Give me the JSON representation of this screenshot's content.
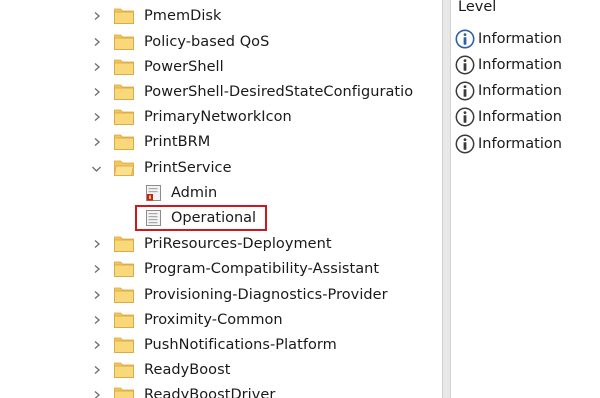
{
  "tree": {
    "items": [
      {
        "label": "PmemDisk",
        "expanded": false
      },
      {
        "label": "Policy-based QoS",
        "expanded": false
      },
      {
        "label": "PowerShell",
        "expanded": false
      },
      {
        "label": "PowerShell-DesiredStateConfiguratio",
        "expanded": false
      },
      {
        "label": "PrimaryNetworkIcon",
        "expanded": false
      },
      {
        "label": "PrintBRM",
        "expanded": false
      },
      {
        "label": "PrintService",
        "expanded": true
      },
      {
        "label": "Admin",
        "child": true
      },
      {
        "label": "Operational",
        "child": true,
        "selected": true
      },
      {
        "label": "PriResources-Deployment",
        "expanded": false
      },
      {
        "label": "Program-Compatibility-Assistant",
        "expanded": false
      },
      {
        "label": "Provisioning-Diagnostics-Provider",
        "expanded": false
      },
      {
        "label": "Proximity-Common",
        "expanded": false
      },
      {
        "label": "PushNotifications-Platform",
        "expanded": false
      },
      {
        "label": "ReadyBoost",
        "expanded": false
      },
      {
        "label": "ReadyBoostDriver",
        "expanded": false
      }
    ],
    "selection_color": "#d0161f",
    "folder_color": "#f5c75a"
  },
  "events_pane": {
    "column_header": "Level",
    "rows": [
      {
        "icon": "information-icon",
        "label": "Information"
      },
      {
        "icon": "information-icon",
        "label": "Information"
      },
      {
        "icon": "information-icon",
        "label": "Information"
      },
      {
        "icon": "information-icon",
        "label": "Information"
      },
      {
        "icon": "information-icon",
        "label": "Information"
      }
    ]
  }
}
